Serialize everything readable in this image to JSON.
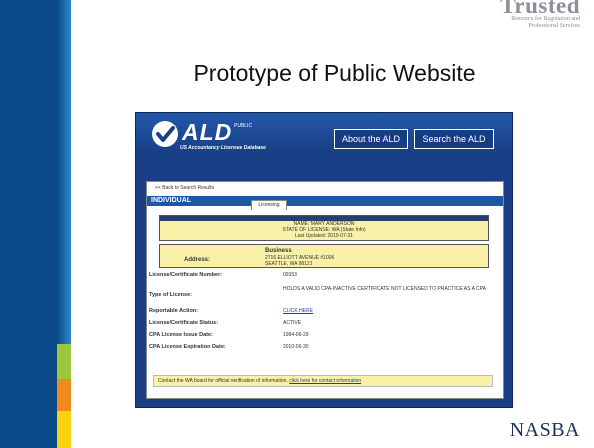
{
  "slide": {
    "brand_word": "Trusted",
    "brand_tagline_1": "Resource for Regulation and",
    "brand_tagline_2": "Professional Services",
    "title": "Prototype of Public Website",
    "footer_logo": "NASBA"
  },
  "colors": {
    "sidebar": "#0a4a88",
    "green": "#9cc63b",
    "orange": "#f08a1c",
    "yellow": "#f6d20f",
    "header_blue": "#1b3f86"
  },
  "ald": {
    "logo_text": "ALD",
    "public_label": "PUBLIC",
    "full_name": "US Accountancy Licensee Database",
    "nav": [
      "About the ALD",
      "Search the ALD"
    ],
    "back_link": "<< Back to Search Results",
    "section": "INDIVIDUAL",
    "tab": "Licensing",
    "name_line": "NAME: MARY ANDERSON",
    "state_line": "STATE OF LICENSE: WA (State Info)",
    "updated_line": "Last Updated: 2010-07-31",
    "address_label": "Address:",
    "address_type": "Business",
    "address_1": "2716 ELLIOTT AVENUE #1006",
    "address_2": "SEATTLE, WA 98121",
    "rows": [
      {
        "key": "License/Certificate Number:",
        "value": "09353"
      },
      {
        "key": "Type of License:",
        "value": "HOLDS A VALID CPA-INACTIVE CERTIFICATE NOT LICENSED TO PRACTICE AS A CPA"
      },
      {
        "key": "Reportable Action:",
        "value": "CLICK HERE"
      },
      {
        "key": "License/Certificate Status:",
        "value": "ACTIVE"
      },
      {
        "key": "CPA License Issue Date:",
        "value": "1984-06-29"
      },
      {
        "key": "CPA License Expiration Date:",
        "value": "2010-06-30"
      }
    ],
    "note_text": "Contact the WA board for official verification of information.",
    "note_link": "click here for contact information"
  }
}
